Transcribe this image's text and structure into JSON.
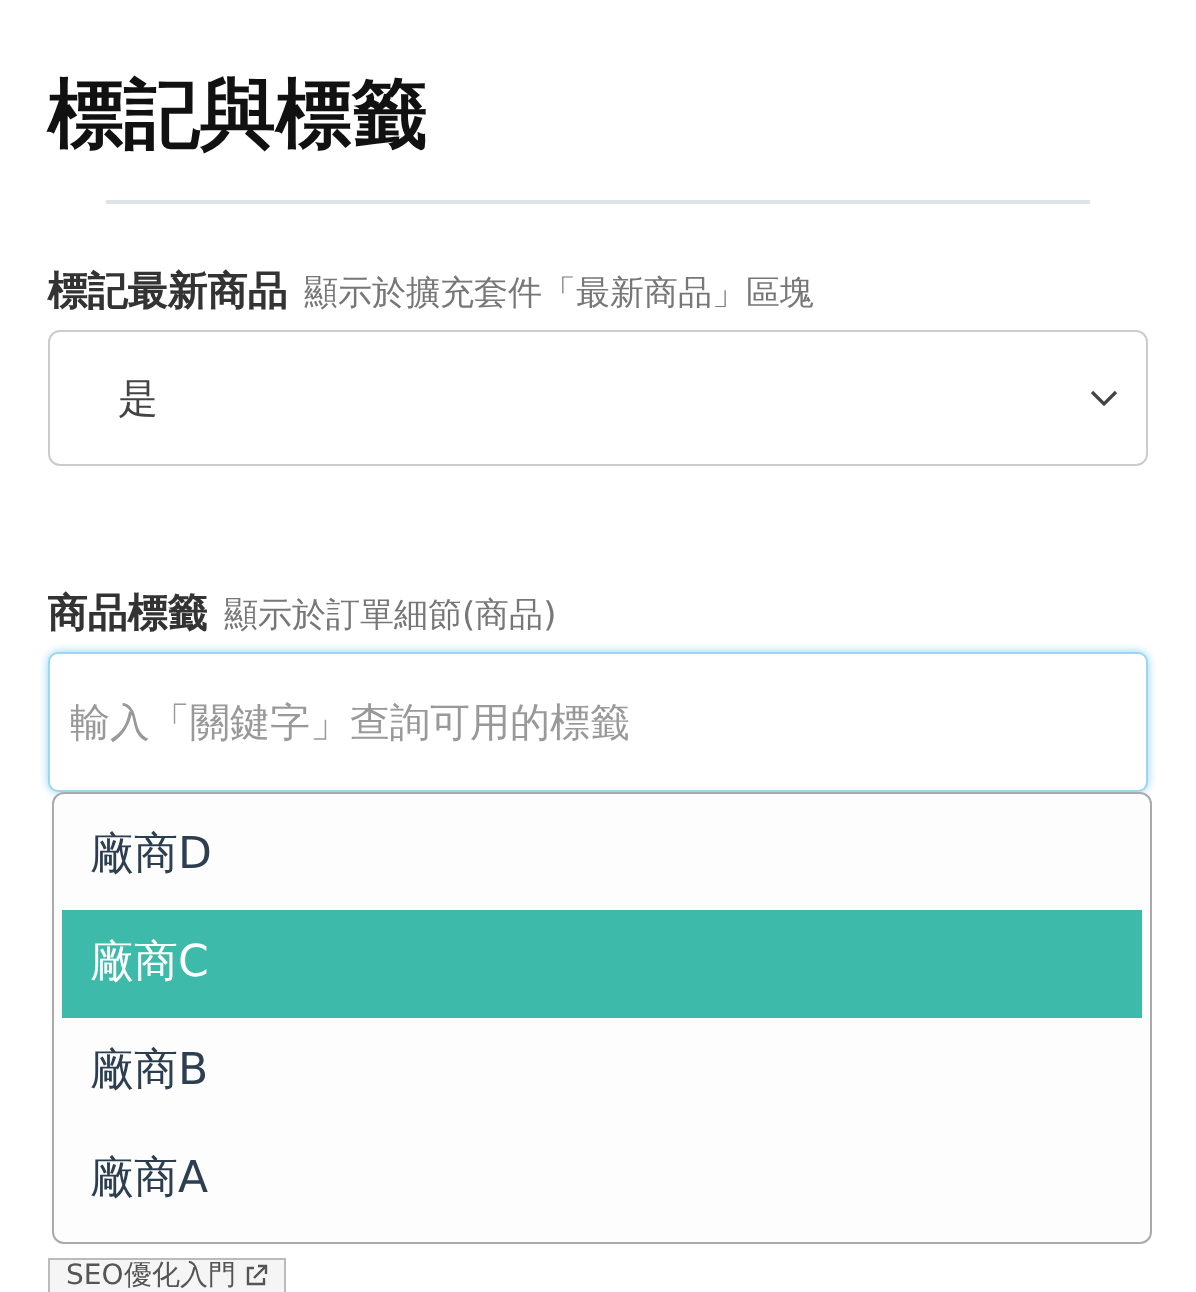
{
  "title": "標記與標籤",
  "fields": [
    {
      "kind": "select",
      "label": "標記最新商品",
      "hint": "顯示於擴充套件「最新商品」區塊",
      "value": "是"
    },
    {
      "kind": "tag-input",
      "label": "商品標籤",
      "hint": "顯示於訂單細節(商品)",
      "placeholder": "輸入「關鍵字」查詢可用的標籤",
      "focused": true,
      "options": [
        {
          "label": "廠商D",
          "selected": false
        },
        {
          "label": "廠商C",
          "selected": true
        },
        {
          "label": "廠商B",
          "selected": false
        },
        {
          "label": "廠商A",
          "selected": false
        }
      ]
    }
  ],
  "links": [
    {
      "label": "SEO優化入門"
    }
  ]
}
